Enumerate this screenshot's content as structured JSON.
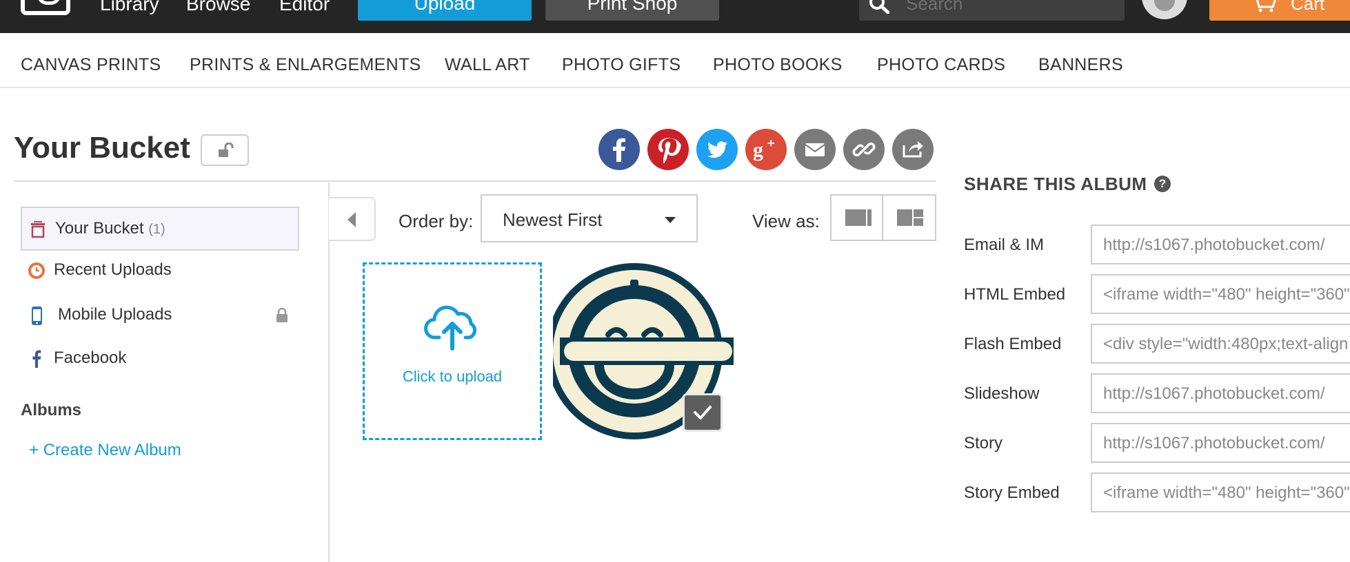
{
  "topbar": {
    "nav": [
      "Library",
      "Browse",
      "Editor"
    ],
    "upload_label": "Upload",
    "printshop_label": "Print Shop",
    "search_placeholder": "Search",
    "cart_label": "Cart"
  },
  "categories": [
    "CANVAS PRINTS",
    "PRINTS & ENLARGEMENTS",
    "WALL ART",
    "PHOTO GIFTS",
    "PHOTO BOOKS",
    "PHOTO CARDS",
    "BANNERS"
  ],
  "page": {
    "title": "Your Bucket"
  },
  "social_icons": [
    "facebook-icon",
    "pinterest-icon",
    "twitter-icon",
    "google-plus-icon",
    "email-icon",
    "link-icon",
    "share-icon"
  ],
  "sidebar": {
    "items": [
      {
        "label": "Your Bucket",
        "count": "(1)",
        "icon": "bucket-icon",
        "active": true
      },
      {
        "label": "Recent Uploads",
        "icon": "clock-icon"
      },
      {
        "label": "Mobile Uploads",
        "icon": "phone-icon",
        "locked": true
      },
      {
        "label": "Facebook",
        "icon": "facebook-icon"
      }
    ],
    "albums_heading": "Albums",
    "create_album": "+ Create New Album"
  },
  "toolbar": {
    "order_label": "Order by:",
    "order_value": "Newest First",
    "view_label": "View as:"
  },
  "upload_tile": {
    "label": "Click to upload"
  },
  "share": {
    "heading": "SHARE THIS ALBUM",
    "help": "?",
    "rows": [
      {
        "label": "Email & IM",
        "value": "http://s1067.photobucket.com/"
      },
      {
        "label": "HTML Embed",
        "value": "<iframe width=\"480\" height=\"360\""
      },
      {
        "label": "Flash Embed",
        "value": "<div style=\"width:480px;text-align"
      },
      {
        "label": "Slideshow",
        "value": "http://s1067.photobucket.com/"
      },
      {
        "label": "Story",
        "value": "http://s1067.photobucket.com/"
      },
      {
        "label": "Story Embed",
        "value": "<iframe width=\"480\" height=\"360\""
      }
    ]
  },
  "colors": {
    "topbar_bg": "#252525",
    "upload_blue": "#129dd9",
    "printshop_gray": "#505050",
    "cart_orange": "#f0883a",
    "facebook": "#3b5998",
    "pinterest": "#cb2027",
    "twitter": "#1da1f2",
    "google_plus": "#dd4b39",
    "share_gray": "#7a7a7a"
  }
}
